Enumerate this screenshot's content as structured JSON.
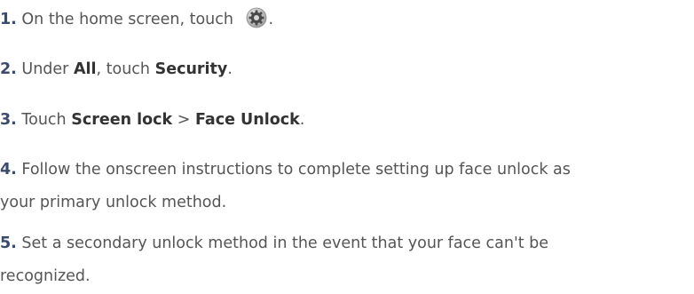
{
  "steps": [
    {
      "number": "1.",
      "text_before": "On the home screen, touch",
      "icon": "settings-gear-icon",
      "text_after": "."
    },
    {
      "number": "2.",
      "text_before": "Under",
      "bold_1": "All",
      "text_mid": ", touch",
      "bold_2": "Security",
      "text_after": "."
    },
    {
      "number": "3.",
      "text_before": "Touch",
      "bold_1": "Screen lock",
      "separator": ">",
      "bold_2": "Face Unlock",
      "text_after": "."
    },
    {
      "number": "4.",
      "line_1": "Follow the onscreen instructions to complete setting up face unlock as",
      "line_2": "your primary unlock method."
    },
    {
      "number": "5.",
      "line_1": "Set a secondary unlock method in the event that your face can't be",
      "line_2": "recognized."
    }
  ]
}
